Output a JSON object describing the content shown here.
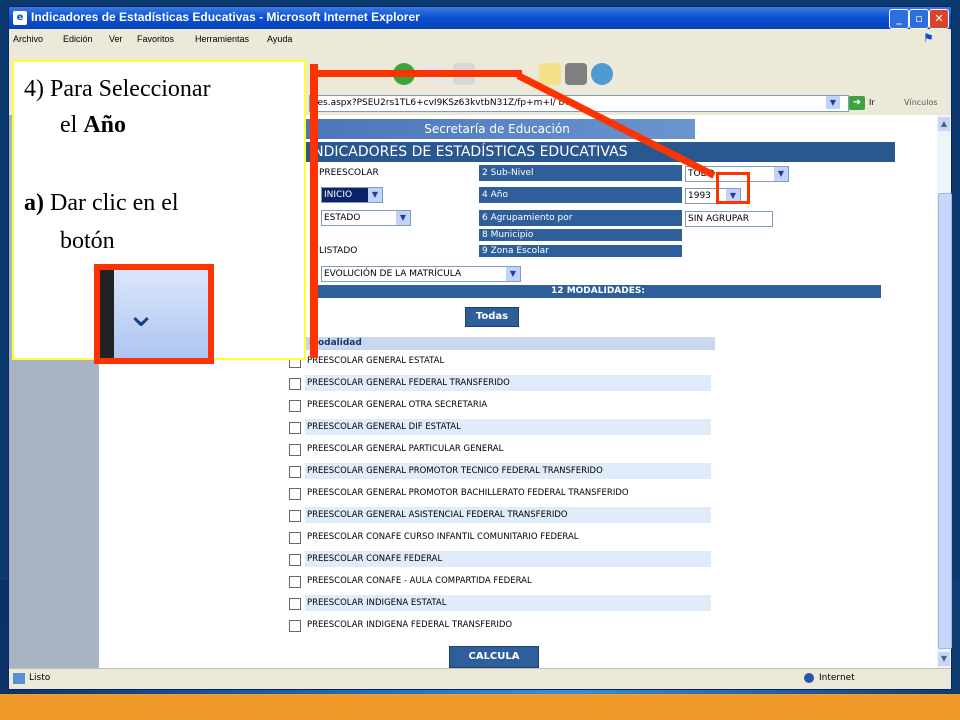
{
  "window": {
    "title": "Indicadores de Estadísticas Educativas - Microsoft Internet Explorer",
    "buttons": [
      "_",
      "▫",
      "✕"
    ]
  },
  "menu": [
    "Archivo",
    "Edición",
    "Ver",
    "Favoritos",
    "Herramientas",
    "Ayuda"
  ],
  "address": {
    "value": "res.aspx?PSEU2rs1TL6+cvI9KSz63kvtbN31Z/fp+m+I/   bY=",
    "go_label": "Ir",
    "links_label": "Vínculos"
  },
  "page": {
    "banner": "Secretaría de Educación",
    "indicadores_title": "INDICADORES DE ESTADÍSTICAS EDUCATIVAS",
    "params": {
      "level_value": "PREESCOLAR",
      "sublevel_label": "2 Sub-Nivel",
      "sublevel_value": "TODO",
      "inicio_value": "INICIO",
      "anio_label": "4 Año",
      "anio_value": "1993",
      "estado_value": "ESTADO",
      "agrupamiento_label": "6 Agrupamiento por",
      "agrupamiento_value": "SIN AGRUPAR",
      "municipio_label": "8 Municipio",
      "listado_value": "LISTADO",
      "zona_label": "9 Zona Escolar",
      "report_value": "EVOLUCIÓN DE LA MATRÍCULA"
    },
    "modalidades_bar": "12 MODALIDADES:",
    "todas_button": "Todas",
    "modalidad_header": "Modalidad",
    "modalidades": [
      "PREESCOLAR GENERAL ESTATAL",
      "PREESCOLAR GENERAL FEDERAL TRANSFERIDO",
      "PREESCOLAR GENERAL OTRA SECRETARIA",
      "PREESCOLAR GENERAL DIF ESTATAL",
      "PREESCOLAR GENERAL PARTICULAR GENERAL",
      "PREESCOLAR GENERAL PROMOTOR TECNICO FEDERAL TRANSFERIDO",
      "PREESCOLAR GENERAL PROMOTOR BACHILLERATO FEDERAL TRANSFERIDO",
      "PREESCOLAR GENERAL ASISTENCIAL FEDERAL TRANSFERIDO",
      "PREESCOLAR CONAFE CURSO INFANTIL COMUNITARIO FEDERAL",
      "PREESCOLAR CONAFE FEDERAL",
      "PREESCOLAR CONAFE - AULA COMPARTIDA FEDERAL",
      "PREESCOLAR INDIGENA ESTATAL",
      "PREESCOLAR INDIGENA FEDERAL TRANSFERIDO"
    ],
    "calcula_button": "CALCULA"
  },
  "status": {
    "text": "Listo",
    "zone": "Internet"
  },
  "callout": {
    "line1": "4) Para Seleccionar",
    "line2_prefix": "el ",
    "line2_bold": "Año",
    "line3_bold": "a)",
    "line3_rest": " Dar clic en el",
    "line4": "botón"
  },
  "colors": {
    "accent_red": "#ff3300",
    "callout_border": "#ffff33",
    "header_blue": "#29578f",
    "slide_orange": "#f09a2c"
  }
}
